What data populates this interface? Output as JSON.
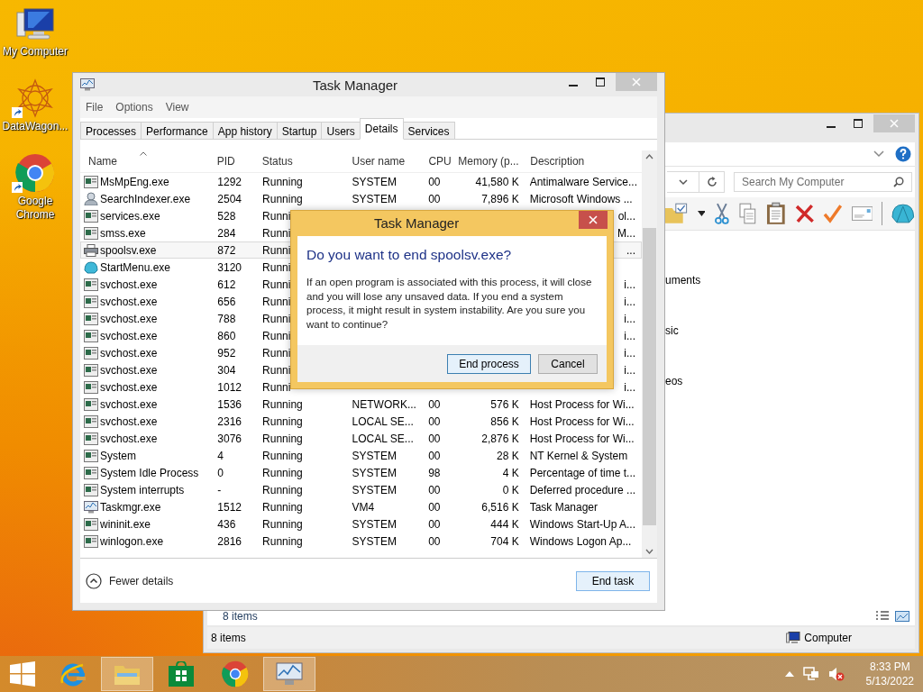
{
  "desktop_icons": [
    {
      "label": "My Computer",
      "kind": "computer",
      "shortcut": false
    },
    {
      "label": "DataWagon...",
      "kind": "mandala",
      "shortcut": true
    },
    {
      "label": "Google Chrome",
      "kind": "chrome",
      "shortcut": true
    }
  ],
  "explorer": {
    "search": {
      "placeholder": "Search My Computer"
    },
    "nav_items": [
      "uments",
      "sic",
      "eos"
    ],
    "item_count": "8 items",
    "status_bar": {
      "count": "8 items",
      "location": "Computer"
    }
  },
  "task_manager": {
    "title": "Task Manager",
    "menu": [
      "File",
      "Options",
      "View"
    ],
    "tabs": [
      {
        "label": "Processes",
        "selected": false
      },
      {
        "label": "Performance",
        "selected": false
      },
      {
        "label": "App history",
        "selected": false
      },
      {
        "label": "Startup",
        "selected": false
      },
      {
        "label": "Users",
        "selected": false
      },
      {
        "label": "Details",
        "selected": true
      },
      {
        "label": "Services",
        "selected": false
      }
    ],
    "columns": [
      "Name",
      "PID",
      "Status",
      "User name",
      "CPU",
      "Memory (p...",
      "Description"
    ],
    "rows": [
      {
        "kind": "exe",
        "name": "MsMpEng.exe",
        "pid": "1292",
        "status": "Running",
        "user": "SYSTEM",
        "cpu": "00",
        "memory": "41,580 K",
        "description": "Antimalware Service...",
        "selected": false
      },
      {
        "kind": "search",
        "name": "SearchIndexer.exe",
        "pid": "2504",
        "status": "Running",
        "user": "SYSTEM",
        "cpu": "00",
        "memory": "7,896 K",
        "description": "Microsoft Windows ...",
        "selected": false
      },
      {
        "kind": "exe",
        "name": "services.exe",
        "pid": "528",
        "status": "Runni",
        "description_tail": "ol...",
        "selected": false
      },
      {
        "kind": "exe",
        "name": "smss.exe",
        "pid": "284",
        "status": "Runni",
        "description_tail": "M...",
        "selected": false
      },
      {
        "kind": "printer",
        "name": "spoolsv.exe",
        "pid": "872",
        "status": "Runni",
        "description_tail": "...",
        "selected": true
      },
      {
        "kind": "shell",
        "name": "StartMenu.exe",
        "pid": "3120",
        "status": "Runni",
        "selected": false
      },
      {
        "kind": "exe",
        "name": "svchost.exe",
        "pid": "612",
        "status": "Runni",
        "description_tail": "i...",
        "selected": false
      },
      {
        "kind": "exe",
        "name": "svchost.exe",
        "pid": "656",
        "status": "Runni",
        "description_tail": "i...",
        "selected": false
      },
      {
        "kind": "exe",
        "name": "svchost.exe",
        "pid": "788",
        "status": "Runni",
        "description_tail": "i...",
        "selected": false
      },
      {
        "kind": "exe",
        "name": "svchost.exe",
        "pid": "860",
        "status": "Runni",
        "description_tail": "i...",
        "selected": false
      },
      {
        "kind": "exe",
        "name": "svchost.exe",
        "pid": "952",
        "status": "Runni",
        "description_tail": "i...",
        "selected": false
      },
      {
        "kind": "exe",
        "name": "svchost.exe",
        "pid": "304",
        "status": "Runni",
        "description_tail": "i...",
        "selected": false
      },
      {
        "kind": "exe",
        "name": "svchost.exe",
        "pid": "1012",
        "status": "Runni",
        "description_tail": "i...",
        "selected": false
      },
      {
        "kind": "exe",
        "name": "svchost.exe",
        "pid": "1536",
        "status": "Running",
        "user": "NETWORK...",
        "cpu": "00",
        "memory": "576 K",
        "description": "Host Process for Wi...",
        "selected": false
      },
      {
        "kind": "exe",
        "name": "svchost.exe",
        "pid": "2316",
        "status": "Running",
        "user": "LOCAL SE...",
        "cpu": "00",
        "memory": "856 K",
        "description": "Host Process for Wi...",
        "selected": false
      },
      {
        "kind": "exe",
        "name": "svchost.exe",
        "pid": "3076",
        "status": "Running",
        "user": "LOCAL SE...",
        "cpu": "00",
        "memory": "2,876 K",
        "description": "Host Process for Wi...",
        "selected": false
      },
      {
        "kind": "exe",
        "name": "System",
        "pid": "4",
        "status": "Running",
        "user": "SYSTEM",
        "cpu": "00",
        "memory": "28 K",
        "description": "NT Kernel & System",
        "selected": false
      },
      {
        "kind": "exe",
        "name": "System Idle Process",
        "pid": "0",
        "status": "Running",
        "user": "SYSTEM",
        "cpu": "98",
        "memory": "4 K",
        "description": "Percentage of time t...",
        "selected": false
      },
      {
        "kind": "exe",
        "name": "System interrupts",
        "pid": "-",
        "status": "Running",
        "user": "SYSTEM",
        "cpu": "00",
        "memory": "0 K",
        "description": "Deferred procedure ...",
        "selected": false
      },
      {
        "kind": "taskmgr",
        "name": "Taskmgr.exe",
        "pid": "1512",
        "status": "Running",
        "user": "VM4",
        "cpu": "00",
        "memory": "6,516 K",
        "description": "Task Manager",
        "selected": false
      },
      {
        "kind": "exe",
        "name": "wininit.exe",
        "pid": "436",
        "status": "Running",
        "user": "SYSTEM",
        "cpu": "00",
        "memory": "444 K",
        "description": "Windows Start-Up A...",
        "selected": false
      },
      {
        "kind": "exe",
        "name": "winlogon.exe",
        "pid": "2816",
        "status": "Running",
        "user": "SYSTEM",
        "cpu": "00",
        "memory": "704 K",
        "description": "Windows Logon Ap...",
        "selected": false
      }
    ],
    "fewer_details": "Fewer details",
    "end_task": "End task"
  },
  "dialog": {
    "title": "Task Manager",
    "heading": "Do you want to end spoolsv.exe?",
    "message": "If an open program is associated with this process, it will close and you will lose any unsaved data. If you end a system process, it might result in system instability. Are you sure you want to continue?",
    "buttons": [
      {
        "label": "End process",
        "default": true
      },
      {
        "label": "Cancel",
        "default": false
      }
    ]
  },
  "taskbar": {
    "apps": [
      {
        "kind": "ie",
        "running": false
      },
      {
        "kind": "explorer",
        "running": true
      },
      {
        "kind": "store",
        "running": false
      },
      {
        "kind": "chrome",
        "running": false
      },
      {
        "kind": "taskmgr",
        "running": true
      }
    ],
    "time": "8:33 PM",
    "date": "5/13/2022"
  }
}
